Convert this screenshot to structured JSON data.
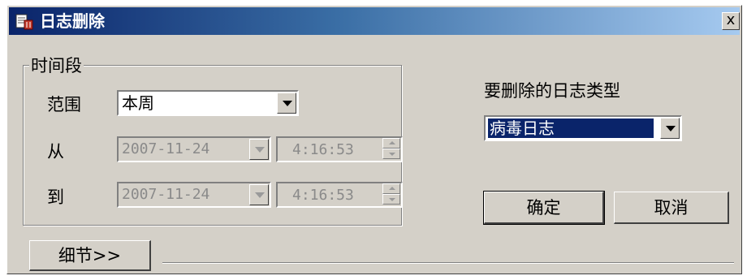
{
  "window": {
    "title": "日志删除",
    "close_label": "x"
  },
  "time_group": {
    "label": "时间段",
    "range": {
      "label": "范围",
      "value": "本周"
    },
    "from": {
      "label": "从",
      "date": "2007-11-24",
      "time": "4:16:53"
    },
    "to": {
      "label": "到",
      "date": "2007-11-24",
      "time": "4:16:53"
    }
  },
  "log_type": {
    "label": "要删除的日志类型",
    "value": "病毒日志"
  },
  "buttons": {
    "ok": "确定",
    "cancel": "取消",
    "details": "细节>>"
  },
  "colors": {
    "face": "#d4d0c8",
    "title_start": "#0a246a",
    "title_end": "#a6caf0",
    "selection": "#0a246a"
  }
}
